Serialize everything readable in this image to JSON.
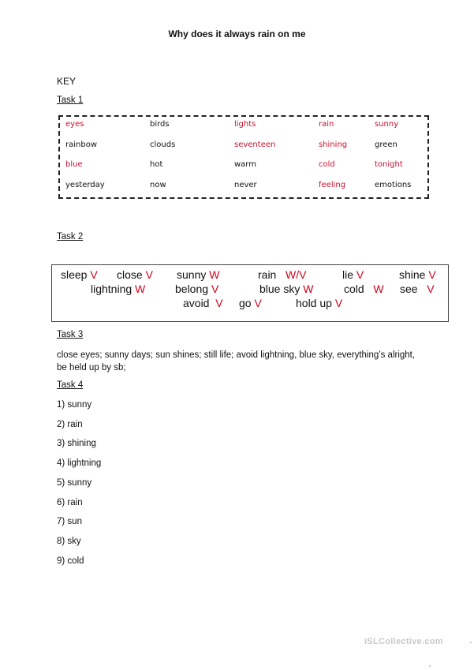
{
  "title": "Why does it always rain on me",
  "key_label": "KEY",
  "task1": {
    "heading": "Task 1",
    "rows": [
      [
        {
          "text": "eyes",
          "marked": true
        },
        {
          "text": "birds",
          "marked": false
        },
        {
          "text": "lights",
          "marked": true
        },
        {
          "text": "rain",
          "marked": true
        },
        {
          "text": "sunny",
          "marked": true
        }
      ],
      [
        {
          "text": "rainbow",
          "marked": false
        },
        {
          "text": "clouds",
          "marked": false
        },
        {
          "text": "seventeen",
          "marked": true
        },
        {
          "text": "shining",
          "marked": true
        },
        {
          "text": "green",
          "marked": false
        }
      ],
      [
        {
          "text": "blue",
          "marked": true
        },
        {
          "text": "hot",
          "marked": false
        },
        {
          "text": "warm",
          "marked": false
        },
        {
          "text": "cold",
          "marked": true
        },
        {
          "text": "tonight",
          "marked": true
        }
      ],
      [
        {
          "text": "yesterday",
          "marked": false
        },
        {
          "text": "now",
          "marked": false
        },
        {
          "text": "never",
          "marked": false
        },
        {
          "text": "feeling",
          "marked": true
        },
        {
          "text": "emotions",
          "marked": false
        }
      ]
    ],
    "marked_color": "#c8102e"
  },
  "task2": {
    "heading": "Task 2",
    "items": [
      {
        "word": "sleep",
        "mark": "V"
      },
      {
        "word": "close",
        "mark": "V"
      },
      {
        "word": "sunny",
        "mark": "W"
      },
      {
        "word": "rain",
        "mark": "W/V"
      },
      {
        "word": "lie",
        "mark": "V"
      },
      {
        "word": "shine",
        "mark": "V"
      },
      {
        "word": "lightning",
        "mark": "W"
      },
      {
        "word": "belong",
        "mark": "V"
      },
      {
        "word": "blue sky",
        "mark": "W"
      },
      {
        "word": "cold",
        "mark": "W"
      },
      {
        "word": "see",
        "mark": "V"
      },
      {
        "word": "avoid",
        "mark": "V"
      },
      {
        "word": "go",
        "mark": "V"
      },
      {
        "word": "hold up",
        "mark": "V"
      }
    ],
    "mark_color": "#d0021b"
  },
  "task3": {
    "heading": "Task 3",
    "text": "close eyes; sunny days; sun shines; still life; avoid lightning, blue sky, everything’s alright, be held up by sb;"
  },
  "task4": {
    "heading": "Task 4",
    "answers": [
      "1) sunny",
      "2) rain",
      "3) shining",
      "4) lightning",
      "5) sunny",
      "6) rain",
      "7) sun",
      "8) sky",
      "9) cold"
    ]
  },
  "watermark": "iSLCollective.com"
}
